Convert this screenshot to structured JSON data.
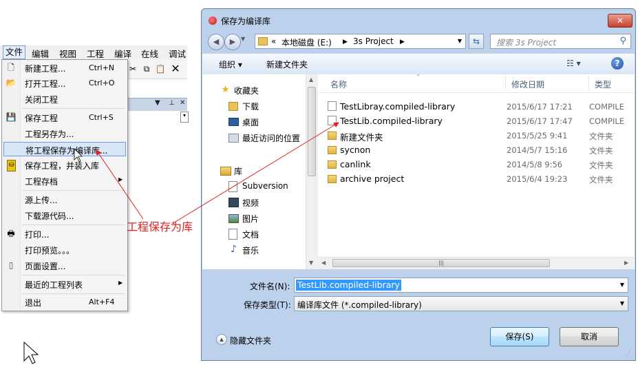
{
  "menubar": {
    "items": [
      "文件",
      "编辑",
      "视图",
      "工程",
      "编译",
      "在线",
      "调试"
    ]
  },
  "file_menu": {
    "items": [
      {
        "label": "新建工程...",
        "shortcut": "Ctrl+N",
        "icon": "new-project-icon"
      },
      {
        "label": "打开工程...",
        "shortcut": "Ctrl+O",
        "icon": "open-folder-icon"
      },
      {
        "label": "关闭工程",
        "shortcut": "",
        "icon": ""
      },
      {
        "label": "保存工程",
        "shortcut": "Ctrl+S",
        "icon": "save-icon"
      },
      {
        "label": "工程另存为...",
        "shortcut": "",
        "icon": ""
      },
      {
        "label": "将工程保存为编译库...",
        "shortcut": "",
        "icon": "",
        "highlighted": true
      },
      {
        "label": "保存工程，并装入库",
        "shortcut": "",
        "icon": "save-install-icon"
      },
      {
        "label": "工程存档",
        "shortcut": "",
        "icon": "",
        "submenu": true
      },
      {
        "label": "源上传...",
        "shortcut": "",
        "icon": ""
      },
      {
        "label": "下载源代码...",
        "shortcut": "",
        "icon": ""
      },
      {
        "label": "打印...",
        "shortcut": "",
        "icon": "printer-icon"
      },
      {
        "label": "打印预览。。。",
        "shortcut": "",
        "icon": ""
      },
      {
        "label": "页面设置...",
        "shortcut": "",
        "icon": "page-setup-icon"
      },
      {
        "label": "最近的工程列表",
        "shortcut": "",
        "icon": "",
        "submenu": true
      },
      {
        "label": "退出",
        "shortcut": "Alt+F4",
        "icon": ""
      }
    ]
  },
  "annotation": "工程保存为库",
  "dialog": {
    "title": "保存为编译库",
    "address": {
      "prefix": "«",
      "crumbs": [
        "本地磁盘 (E:)",
        "3s Project"
      ]
    },
    "search_placeholder": "搜索 3s Project",
    "commands": {
      "organize": "组织 ▾",
      "new_folder": "新建文件夹"
    },
    "nav": {
      "favorites": "收藏夹",
      "favorites_items": [
        "下载",
        "桌面",
        "最近访问的位置"
      ],
      "libraries": "库",
      "libraries_items": [
        "Subversion",
        "视频",
        "图片",
        "文档",
        "音乐"
      ]
    },
    "columns": {
      "name": "名称",
      "date": "修改日期",
      "type": "类型"
    },
    "files": [
      {
        "name": "TestLibray.compiled-library",
        "date": "2015/6/17 17:21",
        "type": "COMPILE",
        "kind": "file"
      },
      {
        "name": "TestLib.compiled-library",
        "date": "2015/6/17 17:47",
        "type": "COMPILE",
        "kind": "file"
      },
      {
        "name": "新建文件夹",
        "date": "2015/5/25 9:41",
        "type": "文件夹",
        "kind": "folder"
      },
      {
        "name": "sycnon",
        "date": "2014/5/7 15:16",
        "type": "文件夹",
        "kind": "folder"
      },
      {
        "name": "canlink",
        "date": "2014/5/8 9:56",
        "type": "文件夹",
        "kind": "folder"
      },
      {
        "name": "archive project",
        "date": "2015/6/4 19:23",
        "type": "文件夹",
        "kind": "folder"
      }
    ],
    "filename_label": "文件名(N):",
    "filename_value": "TestLib.compiled-library",
    "filetype_label": "保存类型(T):",
    "filetype_value": "编译库文件 (*.compiled-library)",
    "hide_folders": "隐藏文件夹",
    "save_button": "保存(S)",
    "cancel_button": "取消"
  },
  "colors": {
    "annotation": "#e02020",
    "selection": "#3399ff",
    "menu_highlight": "#d8e6f7",
    "dialog_frame": "#bcd2ec"
  }
}
